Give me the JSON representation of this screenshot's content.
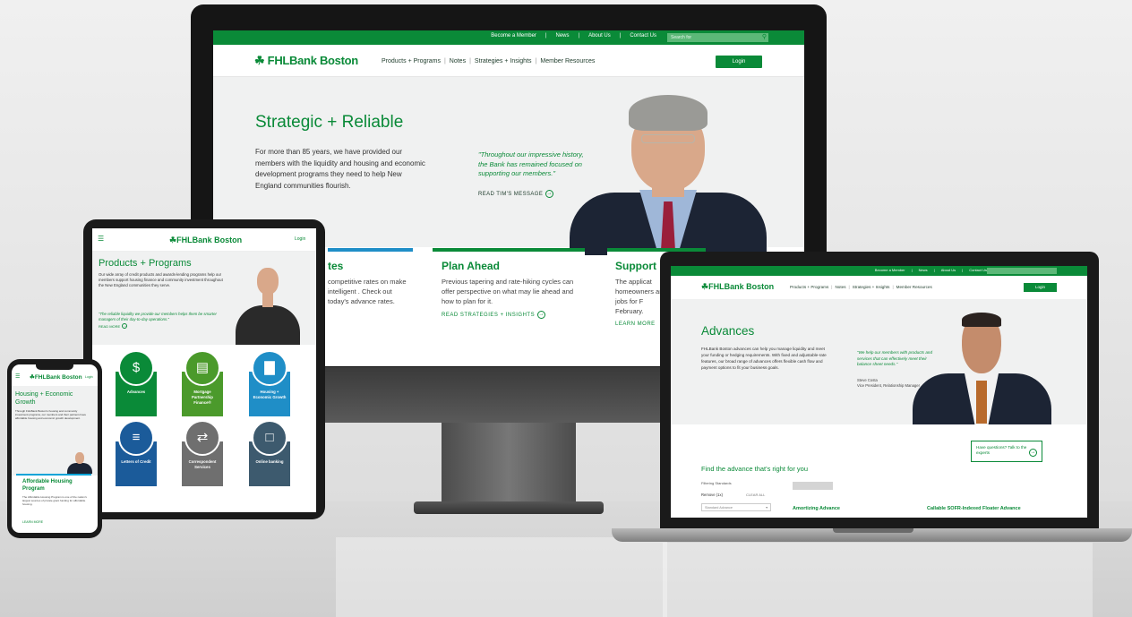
{
  "desktop": {
    "utility_links": [
      "Become a Member",
      "News",
      "About Us",
      "Contact Us"
    ],
    "search_placeholder": "Search for",
    "logo": "FHLBank Boston",
    "nav": [
      "Products + Programs",
      "Notes",
      "Strategies + Insights",
      "Member Resources"
    ],
    "login": "Login",
    "hero_title": "Strategic + Reliable",
    "hero_intro": "For more than 85 years, we have provided our members with the liquidity and housing and economic development programs they need to help New England communities flourish.",
    "hero_quote": "\"Throughout our impressive history, the Bank has remained focused on supporting our members.\"",
    "read_link": "READ TIM'S MESSAGE",
    "cards": [
      {
        "title": "tes",
        "text": "competitive rates on make intelligent . Check out today's advance rates.",
        "link": ""
      },
      {
        "title": "Plan Ahead",
        "text": "Previous tapering and rate-hiking cycles can offer perspective on what may lie ahead and how to plan for it.",
        "link": "READ STRATEGIES + INSIGHTS"
      },
      {
        "title": "Support",
        "text": "The applicat homeowners and jobs for F February.",
        "link": "LEARN MORE"
      }
    ]
  },
  "tablet": {
    "logo": "FHLBank Boston",
    "login": "Login",
    "title": "Products + Programs",
    "intro": "Our wide array of credit products and awards-lending programs help our members support housing finance and community investment throughout the New England communities they serve.",
    "quote": "\"The reliable liquidity we provide our members helps them be smarter managers of their day-to-day operations.\"",
    "read_link": "READ MORE",
    "tiles": [
      {
        "label": "Advances",
        "color": "#0a8a38",
        "icon": "$"
      },
      {
        "label": "Mortgage Partnership Finance®",
        "color": "#4b9a2b",
        "icon": "▤"
      },
      {
        "label": "Housing + Economic Growth",
        "color": "#1f8ec7",
        "icon": "▇"
      },
      {
        "label": "Letters of Credit",
        "color": "#1b5b9a",
        "icon": "≡"
      },
      {
        "label": "Correspondent Services",
        "color": "#6f6f6f",
        "icon": "⇄"
      },
      {
        "label": "Online banking",
        "color": "#3d5a6e",
        "icon": "□"
      }
    ]
  },
  "phone": {
    "logo": "FHLBank Boston",
    "login": "Login",
    "title": "Housing + Economic Growth",
    "intro": "Through FHLBank Boston's housing and community investment programs, our members and their partners have affordable housing and economic growth development.",
    "card_title": "Affordable Housing Program",
    "card_text": "The Affordable Housing Program is one of the nation's largest sources of private grant funding for affordable housing.",
    "card_link": "LEARN MORE"
  },
  "laptop": {
    "utility_links": [
      "Become a Member",
      "News",
      "About Us",
      "Contact Us"
    ],
    "logo": "FHLBank Boston",
    "nav": [
      "Products + Programs",
      "Notes",
      "Strategies + Insights",
      "Member Resources"
    ],
    "login": "Login",
    "title": "Advances",
    "intro": "FHLBank Boston advances can help you manage liquidity and meet your funding or hedging requirements. With fixed and adjustable-rate features, our broad range of advances offers flexible cash flow and payment options to fit your business goals.",
    "quote": "\"We help our members with products and services that can effectively meet their balance sheet needs.\"",
    "attribution": "Steve Costa\nVice President, Relationship Manager",
    "questions": "Have questions? Talk to the experts",
    "find": "Find the advance that's right for you",
    "filter_label": "Filtering Standards",
    "filter_remove": "Remove (1x)",
    "clear_all": "CLEAR ALL",
    "select": "Standard Advance",
    "col1": "Amortizing Advance",
    "col2": "Callable SOFR-Indexed Floater Advance"
  }
}
